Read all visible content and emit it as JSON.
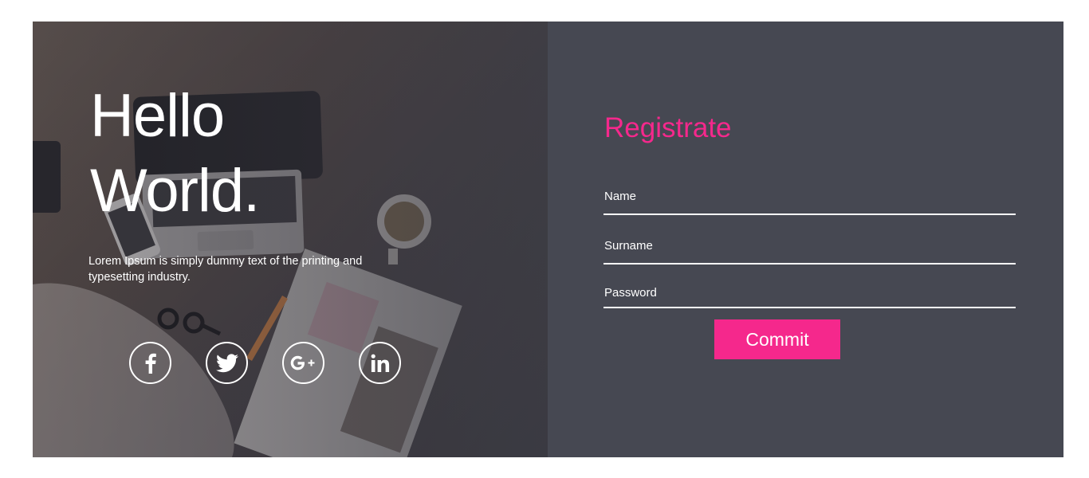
{
  "hero": {
    "title_line1": "Hello",
    "title_line2": "World.",
    "description": "Lorem Ipsum is simply dummy text of the printing and typesetting industry.",
    "social": [
      {
        "icon": "facebook-icon"
      },
      {
        "icon": "twitter-icon"
      },
      {
        "icon": "google-plus-icon"
      },
      {
        "icon": "linkedin-icon"
      }
    ]
  },
  "form": {
    "title": "Registrate",
    "name_placeholder": "Name",
    "surname_placeholder": "Surname",
    "password_placeholder": "Password",
    "submit_label": "Commit"
  },
  "colors": {
    "accent": "#f5288c",
    "panel": "#464852",
    "text": "#ffffff"
  }
}
